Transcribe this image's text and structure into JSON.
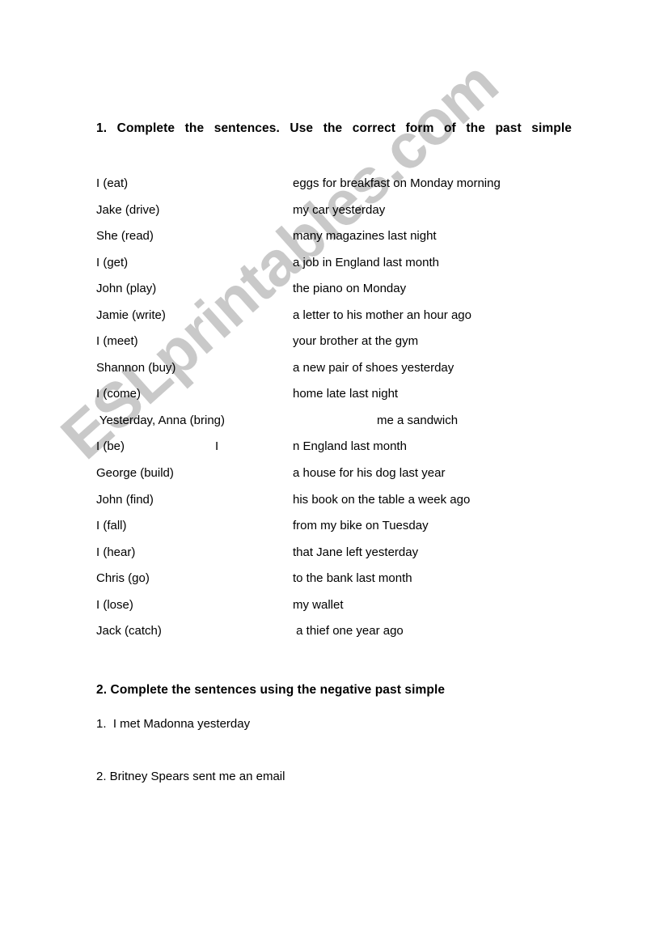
{
  "page": {
    "background_color": "#ffffff",
    "text_color": "#000000"
  },
  "watermark": {
    "text": "ESLprintables.com",
    "color": "#c9c9c9",
    "rotation_deg": -41.8
  },
  "exercise_1": {
    "heading": "1. Complete the sentences. Use the correct form of the past simple",
    "rows": [
      {
        "prompt": "I (eat)",
        "gap_mark": "",
        "completion": "eggs for breakfast on Monday morning"
      },
      {
        "prompt": "Jake (drive)",
        "gap_mark": "",
        "completion": "my car yesterday"
      },
      {
        "prompt": "She (read)",
        "gap_mark": "",
        "completion": "many magazines last night"
      },
      {
        "prompt": "I (get)",
        "gap_mark": "",
        "completion": "a job in England last month"
      },
      {
        "prompt": "John (play)",
        "gap_mark": "",
        "completion": "the piano on Monday"
      },
      {
        "prompt": "Jamie (write)",
        "gap_mark": "",
        "completion": "a letter to his mother an hour ago"
      },
      {
        "prompt": "I (meet)",
        "gap_mark": "",
        "completion": "your brother at the gym"
      },
      {
        "prompt": "Shannon (buy)",
        "gap_mark": "",
        "completion": "a new pair of shoes yesterday"
      },
      {
        "prompt": "I (come)",
        "gap_mark": "",
        "completion": "home late last night"
      },
      {
        "prompt": " Yesterday, Anna (bring)",
        "gap_mark": "",
        "completion": "me a sandwich"
      },
      {
        "prompt": "I (be)",
        "gap_mark": "I",
        "completion": "n England last month"
      },
      {
        "prompt": "George (build)",
        "gap_mark": "",
        "completion": "a house for his dog last year"
      },
      {
        "prompt": "John (find)",
        "gap_mark": "",
        "completion": "his book on the table a week ago"
      },
      {
        "prompt": "I (fall)",
        "gap_mark": "",
        "completion": "from my bike on Tuesday"
      },
      {
        "prompt": "I (hear)",
        "gap_mark": "",
        "completion": "that Jane left yesterday"
      },
      {
        "prompt": "Chris (go)",
        "gap_mark": "",
        "completion": "to the bank last month"
      },
      {
        "prompt": "I (lose)",
        "gap_mark": "",
        "completion": "my wallet"
      },
      {
        "prompt": "Jack (catch)",
        "gap_mark": "",
        "completion": " a thief one year ago"
      }
    ]
  },
  "exercise_2": {
    "heading": "2. Complete the sentences using the negative past simple",
    "items": [
      "1.  I met Madonna yesterday",
      "2. Britney Spears sent me an email"
    ]
  }
}
